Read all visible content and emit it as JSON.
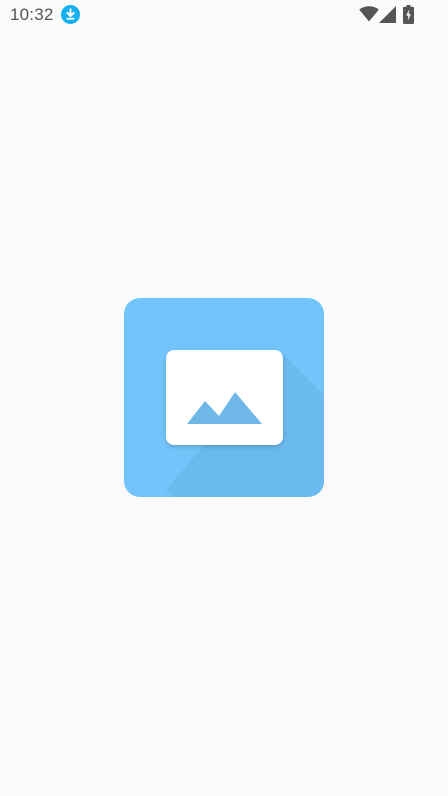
{
  "status_bar": {
    "time": "10:32",
    "icons": [
      "download-notification-icon",
      "wifi-icon",
      "signal-icon",
      "battery-charging-icon"
    ]
  },
  "splash": {
    "logo": "image-placeholder-icon"
  },
  "colors": {
    "background": "#fafafa",
    "logo_tile": "#73c4fb",
    "logo_shadow": "#6ab9ef",
    "logo_card": "#ffffff",
    "mountains": "#6fb7e6",
    "download_badge": "#15b0ed",
    "status_icons": "#555555"
  }
}
